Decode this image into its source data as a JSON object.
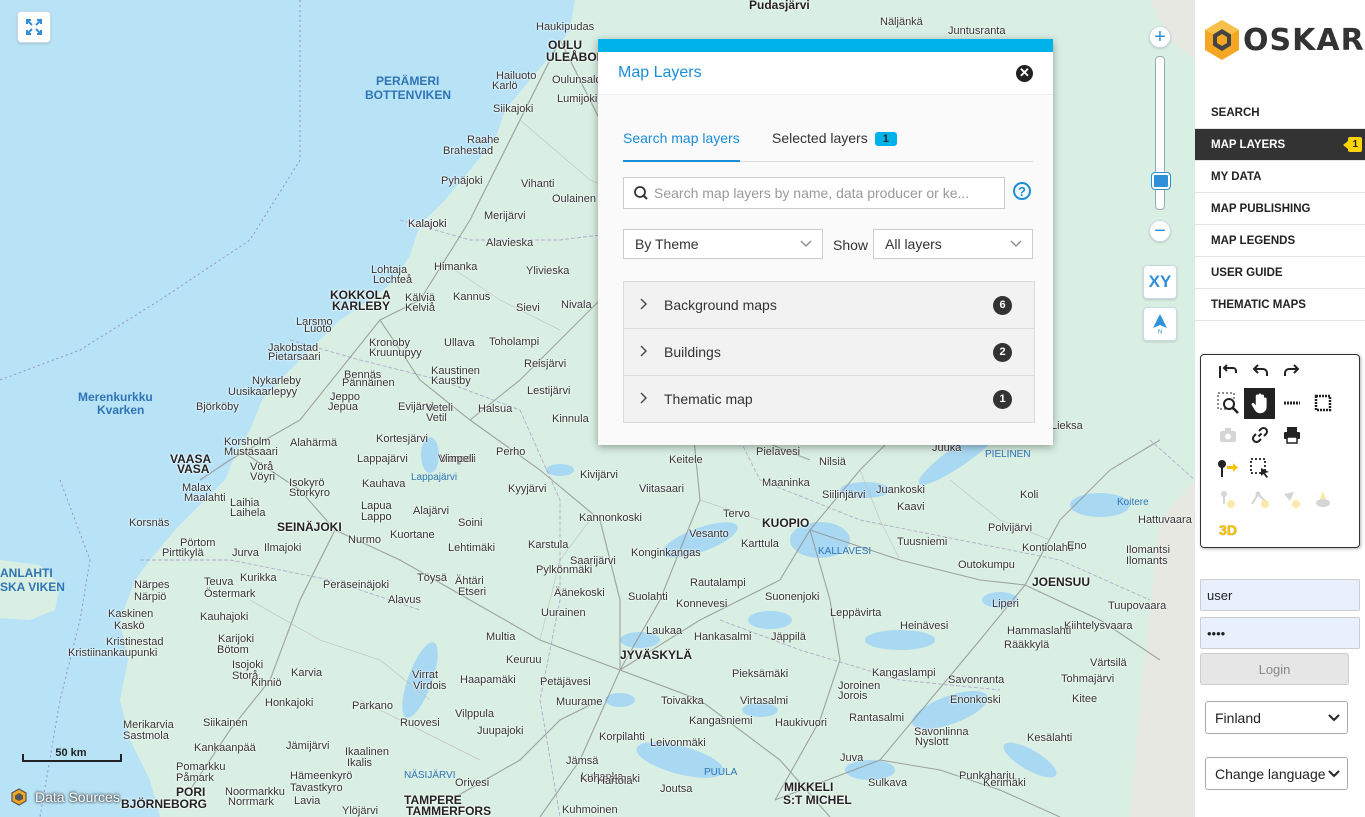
{
  "map": {
    "places": [
      {
        "t": "Pudasjärvi",
        "c": "big2"
      },
      {
        "t": "Haukipudas"
      },
      {
        "t": "Näljänkä"
      },
      {
        "t": "Juntusranta"
      },
      {
        "t": "OULU",
        "c": "big"
      },
      {
        "t": "ULEÅBORG",
        "c": "big"
      },
      {
        "t": "PERÄMERI",
        "c": "water"
      },
      {
        "t": "BOTTENVIKEN",
        "c": "water"
      },
      {
        "t": "Hailuoto"
      },
      {
        "t": "Karlö"
      },
      {
        "t": "Oulunsalo"
      },
      {
        "t": "Lumijoki"
      },
      {
        "t": "Siikajoki"
      },
      {
        "t": "Raahe"
      },
      {
        "t": "Brahestad"
      },
      {
        "t": "Pyhäjoki"
      },
      {
        "t": "Vihanti"
      },
      {
        "t": "Merijärvi"
      },
      {
        "t": "Oulainen"
      },
      {
        "t": "Kalajoki"
      },
      {
        "t": "Alavieska"
      },
      {
        "t": "Himanka"
      },
      {
        "t": "Ylivieska"
      },
      {
        "t": "Lohtaja"
      },
      {
        "t": "Lochteå"
      },
      {
        "t": "KOKKOLA",
        "c": "big"
      },
      {
        "t": "KARLEBY",
        "c": "big"
      },
      {
        "t": "Kälviä"
      },
      {
        "t": "Kelviå"
      },
      {
        "t": "Kannus"
      },
      {
        "t": "Sievi"
      },
      {
        "t": "Nivala"
      },
      {
        "t": "Larsmo"
      },
      {
        "t": "Luoto"
      },
      {
        "t": "Kronoby"
      },
      {
        "t": "Kruunupyy"
      },
      {
        "t": "Ullava"
      },
      {
        "t": "Toholampi"
      },
      {
        "t": "Jakobstad"
      },
      {
        "t": "Pietarsaari"
      },
      {
        "t": "Bennäs"
      },
      {
        "t": "Pännäinen"
      },
      {
        "t": "Kaustinen"
      },
      {
        "t": "Kaustby"
      },
      {
        "t": "Reisjärvi"
      },
      {
        "t": "Nykarleby"
      },
      {
        "t": "Uusikaarlepyy"
      },
      {
        "t": "Jeppo"
      },
      {
        "t": "Jepua"
      },
      {
        "t": "Lestijärvi"
      },
      {
        "t": "Merenkurkku",
        "c": "water"
      },
      {
        "t": "Kvarken",
        "c": "water"
      },
      {
        "t": "Björköby"
      },
      {
        "t": "Evijärvi"
      },
      {
        "t": "Veteli"
      },
      {
        "t": "Vetil"
      },
      {
        "t": "Halsua"
      },
      {
        "t": "Kinnula"
      },
      {
        "t": "Korsholm"
      },
      {
        "t": "Mustasaari"
      },
      {
        "t": "Alahärmä"
      },
      {
        "t": "Kortesjärvi"
      },
      {
        "t": "Perho"
      },
      {
        "t": "VAASA",
        "c": "big"
      },
      {
        "t": "VASA",
        "c": "big"
      },
      {
        "t": "Vörå"
      },
      {
        "t": "Vöyri"
      },
      {
        "t": "Lappajärvi"
      },
      {
        "t": "Vimpeli"
      },
      {
        "t": "Malax"
      },
      {
        "t": "Maalahti"
      },
      {
        "t": "Isokyrö"
      },
      {
        "t": "Storkyro"
      },
      {
        "t": "Kauhava"
      },
      {
        "t": "Kyyjärvi"
      },
      {
        "t": "Kivijärvi"
      },
      {
        "t": "Laihia"
      },
      {
        "t": "Laihela"
      },
      {
        "t": "Lapua"
      },
      {
        "t": "Lappo"
      },
      {
        "t": "Alajärvi"
      },
      {
        "t": "Korsnäs"
      },
      {
        "t": "SEINÄJOKI",
        "c": "big"
      },
      {
        "t": "Nurmo"
      },
      {
        "t": "Kuortane"
      },
      {
        "t": "Soini"
      },
      {
        "t": "Karstula"
      },
      {
        "t": "Pörtom"
      },
      {
        "t": "Pirttikylä"
      },
      {
        "t": "Jurva"
      },
      {
        "t": "Ilmajoki"
      },
      {
        "t": "Lehtimäki"
      },
      {
        "t": "ANLAHTI",
        "c": "water"
      },
      {
        "t": "SKA VIKEN",
        "c": "water"
      },
      {
        "t": "Teuva"
      },
      {
        "t": "Östermark"
      },
      {
        "t": "Kurikka"
      },
      {
        "t": "Töysä"
      },
      {
        "t": "Ähtäri"
      },
      {
        "t": "Etseri"
      },
      {
        "t": "Närpes"
      },
      {
        "t": "Närpiö"
      },
      {
        "t": "Peräseinäjoki"
      },
      {
        "t": "Alavus"
      },
      {
        "t": "Pylkönmäki"
      },
      {
        "t": "Saarijärvi"
      },
      {
        "t": "Kaskinen"
      },
      {
        "t": "Kaskö"
      },
      {
        "t": "Kauhajoki"
      },
      {
        "t": "Äänekoski"
      },
      {
        "t": "Uurainen"
      },
      {
        "t": "Kristinestad"
      },
      {
        "t": "Kristiinankaupunki"
      },
      {
        "t": "Karijoki"
      },
      {
        "t": "Bötom"
      },
      {
        "t": "Multia"
      },
      {
        "t": "Laukaa"
      },
      {
        "t": "Isojoki"
      },
      {
        "t": "Storå"
      },
      {
        "t": "Karvia"
      },
      {
        "t": "Keuruu"
      },
      {
        "t": "Petäjävesi"
      },
      {
        "t": "JYVÄSKYLÄ",
        "c": "big"
      },
      {
        "t": "Kihniö"
      },
      {
        "t": "Virrat"
      },
      {
        "t": "Virdois"
      },
      {
        "t": "Haapamäki"
      },
      {
        "t": "Muurame"
      },
      {
        "t": "Honkajoki"
      },
      {
        "t": "Parkano"
      },
      {
        "t": "Vilppula"
      },
      {
        "t": "Toivakka"
      },
      {
        "t": "Merikarvia"
      },
      {
        "t": "Sastmola"
      },
      {
        "t": "Siikainen"
      },
      {
        "t": "Ruovesi"
      },
      {
        "t": "Jämsä"
      },
      {
        "t": "Korpilahti"
      },
      {
        "t": "Kankaanpää"
      },
      {
        "t": "Jämijärvi"
      },
      {
        "t": "Ikaalinen"
      },
      {
        "t": "Ikalis"
      },
      {
        "t": "Juupajoki"
      },
      {
        "t": "Leivonmäki"
      },
      {
        "t": "Pomarkku"
      },
      {
        "t": "Påmark"
      },
      {
        "t": "Hämeenkyrö"
      },
      {
        "t": "Tavastkyro"
      },
      {
        "t": "Orivesi"
      },
      {
        "t": "Luhanka"
      },
      {
        "t": "PORI",
        "c": "big"
      },
      {
        "t": "BJÖRNEBORG",
        "c": "big"
      },
      {
        "t": "Noormarkku"
      },
      {
        "t": "Norrmark"
      },
      {
        "t": "Lavia"
      },
      {
        "t": "Ylöjärvi"
      },
      {
        "t": "TAMPERE",
        "c": "big"
      },
      {
        "t": "TAMMERFORS",
        "c": "big"
      },
      {
        "t": "Korkeakoski"
      },
      {
        "t": "Kuhmoinen"
      },
      {
        "t": "Pielavesi"
      },
      {
        "t": "Nilsiä"
      },
      {
        "t": "Juuka"
      },
      {
        "t": "Lieksa"
      },
      {
        "t": "PIELINEN",
        "c": "lake"
      },
      {
        "t": "Keitele"
      },
      {
        "t": "Maaninka"
      },
      {
        "t": "Siilinjärvi"
      },
      {
        "t": "Juankoski"
      },
      {
        "t": "Koli"
      },
      {
        "t": "Viitasaari"
      },
      {
        "t": "Kannonkoski"
      },
      {
        "t": "Vesanto"
      },
      {
        "t": "Tervo"
      },
      {
        "t": "KUOPIO",
        "c": "big"
      },
      {
        "t": "Kaavi"
      },
      {
        "t": "Polvijärvi"
      },
      {
        "t": "Kontiolahti"
      },
      {
        "t": "Konginkangas"
      },
      {
        "t": "Karttula"
      },
      {
        "t": "KALLAVESI",
        "c": "lake"
      },
      {
        "t": "Tuusniemi"
      },
      {
        "t": "Outokumpu"
      },
      {
        "t": "Eno"
      },
      {
        "t": "Rautalampi"
      },
      {
        "t": "Suolahti"
      },
      {
        "t": "Konnevesi"
      },
      {
        "t": "Suonenjoki"
      },
      {
        "t": "Leppävirta"
      },
      {
        "t": "Heinävesi"
      },
      {
        "t": "Hankasalmi"
      },
      {
        "t": "Jäppilä"
      },
      {
        "t": "Pieksämäki"
      },
      {
        "t": "Joroinen"
      },
      {
        "t": "Jorois"
      },
      {
        "t": "Kangasniemi"
      },
      {
        "t": "Haukivuori"
      },
      {
        "t": "Rantasalmi"
      },
      {
        "t": "Savonlinna"
      },
      {
        "t": "Nyslott"
      },
      {
        "t": "Hartola"
      },
      {
        "t": "Juva"
      },
      {
        "t": "Sulkava"
      },
      {
        "t": "PUULA",
        "c": "lake"
      },
      {
        "t": "Joutsa"
      },
      {
        "t": "MIKKELI",
        "c": "big2"
      },
      {
        "t": "S:T MICHEL",
        "c": "big2"
      },
      {
        "t": "Enonkoski"
      },
      {
        "t": "Punkaharju"
      },
      {
        "t": "Kerimäki"
      },
      {
        "t": "JOENSUU",
        "c": "big"
      },
      {
        "t": "Liperi"
      },
      {
        "t": "Rääkkylä"
      },
      {
        "t": "Kitee"
      },
      {
        "t": "Tohmajärvi"
      },
      {
        "t": "Värtsilä"
      },
      {
        "t": "Ilomantsi"
      },
      {
        "t": "Ilomants"
      },
      {
        "t": "Hattuvaara"
      },
      {
        "t": "Koitere",
        "c": "lake"
      },
      {
        "t": "Tuupovaara"
      },
      {
        "t": "Kiihtelysvaara"
      },
      {
        "t": "Kesälahti"
      },
      {
        "t": "Kangaslampi"
      },
      {
        "t": "Savonranta"
      },
      {
        "t": "Hammaslahti"
      },
      {
        "t": "Virtasalmi"
      },
      {
        "t": "NÄSIJÄRVI",
        "c": "lake"
      },
      {
        "t": "Lappajärvi",
        "c": "lake"
      },
      {
        "t": "Oulujärvi"
      },
      {
        "t": "Kalajoki"
      },
      {
        "t": "Vimpeli"
      }
    ],
    "scale_label": "50 km",
    "datasources_label": "Data Sources",
    "xy_label": "XY",
    "zoom_level_fraction": 0.15
  },
  "flyout": {
    "title": "Map Layers",
    "tabs": [
      {
        "label": "Search map layers",
        "active": true
      },
      {
        "label": "Selected layers",
        "badge": "1"
      }
    ],
    "search_placeholder": "Search map layers by name, data producer or ke...",
    "group_by": "By Theme",
    "show_label": "Show",
    "show_filter": "All layers",
    "groups": [
      {
        "name": "Background maps",
        "count": "6"
      },
      {
        "name": "Buildings",
        "count": "2"
      },
      {
        "name": "Thematic map",
        "count": "1"
      }
    ]
  },
  "sidebar": {
    "logo_text": "OSKARI",
    "menu": [
      {
        "label": "SEARCH"
      },
      {
        "label": "MAP LAYERS",
        "active": true,
        "badge": "1"
      },
      {
        "label": "MY DATA"
      },
      {
        "label": "MAP PUBLISHING"
      },
      {
        "label": "MAP LEGENDS"
      },
      {
        "label": "USER GUIDE"
      },
      {
        "label": "THEMATIC MAPS"
      }
    ],
    "tools": [
      {
        "icon": "history-back-icon"
      },
      {
        "icon": "undo-icon"
      },
      {
        "icon": "redo-icon"
      },
      {
        "icon": "zoom-box-icon"
      },
      {
        "icon": "pan-hand-icon",
        "selected": true
      },
      {
        "icon": "measure-line-icon"
      },
      {
        "icon": "measure-area-icon"
      },
      {
        "icon": "camera-icon",
        "disabled": true
      },
      {
        "icon": "link-icon"
      },
      {
        "icon": "print-icon"
      },
      {
        "icon": "marker-add-icon"
      },
      {
        "icon": "select-features-icon"
      },
      {
        "icon": "draw-point-icon",
        "disabled": true
      },
      {
        "icon": "draw-line-icon",
        "disabled": true
      },
      {
        "icon": "draw-area-icon",
        "disabled": true
      },
      {
        "icon": "clear-drawing-icon",
        "disabled": true
      },
      {
        "icon": "3d-view-icon",
        "label": "3D"
      }
    ],
    "username": "user",
    "password": "••••",
    "login_label": "Login",
    "country": "Finland",
    "language_label": "Change language"
  }
}
